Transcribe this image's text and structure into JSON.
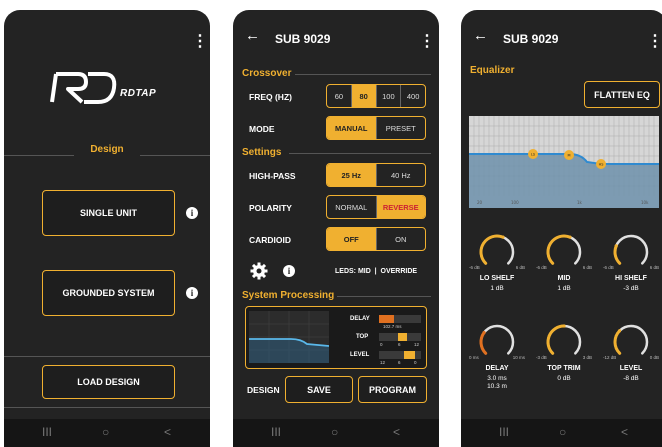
{
  "colors": {
    "accent": "#f0b030",
    "background": "#232323",
    "reverse": "#cc2233",
    "graph_line": "#3aa0d8"
  },
  "screen1": {
    "logo_mark": "RD",
    "logo_text": "RDTAP",
    "section": "Design",
    "buttons": {
      "single": "SINGLE UNIT",
      "grounded": "GROUNDED SYSTEM",
      "load": "LOAD DESIGN"
    }
  },
  "screen2": {
    "title": "SUB 9029",
    "crossover": "Crossover",
    "freq_label": "FREQ (HZ)",
    "freq_options": [
      "60",
      "80",
      "100",
      "400"
    ],
    "freq_selected": "80",
    "mode_label": "MODE",
    "mode_options": [
      "MANUAL",
      "PRESET"
    ],
    "mode_selected": "MANUAL",
    "settings": "Settings",
    "highpass_label": "HIGH-PASS",
    "highpass_options": [
      "25 Hz",
      "40 Hz"
    ],
    "highpass_selected": "25 Hz",
    "polarity_label": "POLARITY",
    "polarity_options": [
      "NORMAL",
      "REVERSE"
    ],
    "polarity_selected": "REVERSE",
    "cardioid_label": "CARDIOID",
    "cardioid_options": [
      "OFF",
      "ON"
    ],
    "cardioid_selected": "OFF",
    "leds_text": "LEDS: MID  |  OVERRIDE",
    "system_processing": "System Processing",
    "proc": {
      "delay_label": "DELAY",
      "delay_value": "102.7 ms",
      "top_label": "TOP",
      "top_scale": [
        "0",
        "6",
        "12"
      ],
      "level_label": "LEVEL",
      "level_scale": [
        "12",
        "6",
        "0"
      ]
    },
    "design_label": "DESIGN",
    "save": "SAVE",
    "program": "PROGRAM"
  },
  "screen3": {
    "title": "SUB 9029",
    "equalizer": "Equalizer",
    "flatten": "FLATTEN EQ",
    "graph_markers": [
      "LS",
      "M",
      "HS"
    ],
    "graph_axis": [
      "20",
      "100",
      "1k",
      "10k"
    ],
    "knobs": [
      {
        "name": "LO SHELF",
        "value": "1 dB",
        "min": "-6 dB",
        "max": "6 dB"
      },
      {
        "name": "MID",
        "value": "1 dB",
        "min": "-6 dB",
        "max": "6 dB"
      },
      {
        "name": "HI SHELF",
        "value": "-3 dB",
        "min": "-6 dB",
        "max": "6 dB"
      },
      {
        "name": "DELAY",
        "value": "3.0 ms",
        "value2": "10.3 m",
        "min": "0 ms",
        "max": "10 ms"
      },
      {
        "name": "TOP TRIM",
        "value": "0 dB",
        "min": "-3 dB",
        "max": "3 dB"
      },
      {
        "name": "LEVEL",
        "value": "-8 dB",
        "min": "-12 dB",
        "max": "0 dB"
      }
    ]
  },
  "navbar": {
    "recents": "III",
    "home": "○",
    "back": "<"
  }
}
